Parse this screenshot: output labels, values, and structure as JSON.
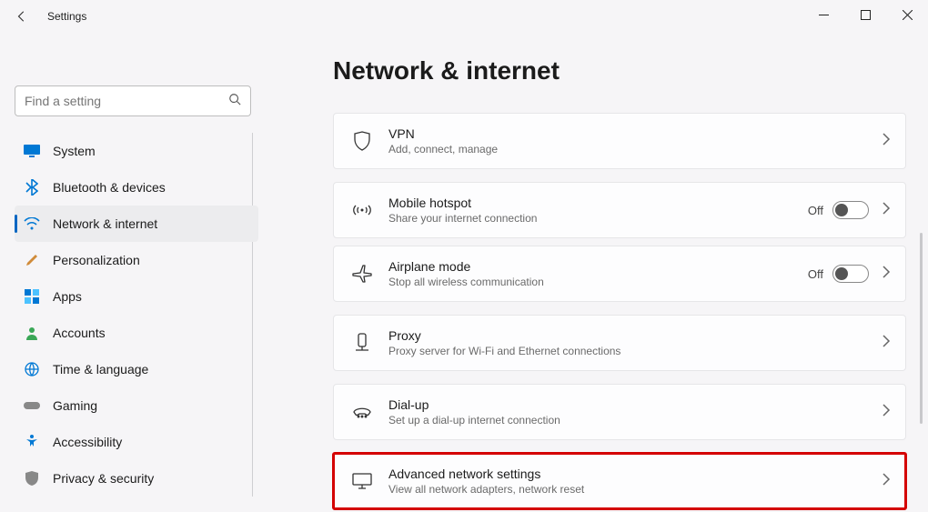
{
  "window": {
    "title": "Settings"
  },
  "search": {
    "placeholder": "Find a setting"
  },
  "sidebar": {
    "items": [
      {
        "label": "System"
      },
      {
        "label": "Bluetooth & devices"
      },
      {
        "label": "Network & internet"
      },
      {
        "label": "Personalization"
      },
      {
        "label": "Apps"
      },
      {
        "label": "Accounts"
      },
      {
        "label": "Time & language"
      },
      {
        "label": "Gaming"
      },
      {
        "label": "Accessibility"
      },
      {
        "label": "Privacy & security"
      }
    ]
  },
  "page": {
    "title": "Network & internet",
    "cards": [
      {
        "title": "VPN",
        "sub": "Add, connect, manage"
      },
      {
        "title": "Mobile hotspot",
        "sub": "Share your internet connection",
        "toggle": "Off"
      },
      {
        "title": "Airplane mode",
        "sub": "Stop all wireless communication",
        "toggle": "Off"
      },
      {
        "title": "Proxy",
        "sub": "Proxy server for Wi-Fi and Ethernet connections"
      },
      {
        "title": "Dial-up",
        "sub": "Set up a dial-up internet connection"
      },
      {
        "title": "Advanced network settings",
        "sub": "View all network adapters, network reset"
      }
    ]
  }
}
